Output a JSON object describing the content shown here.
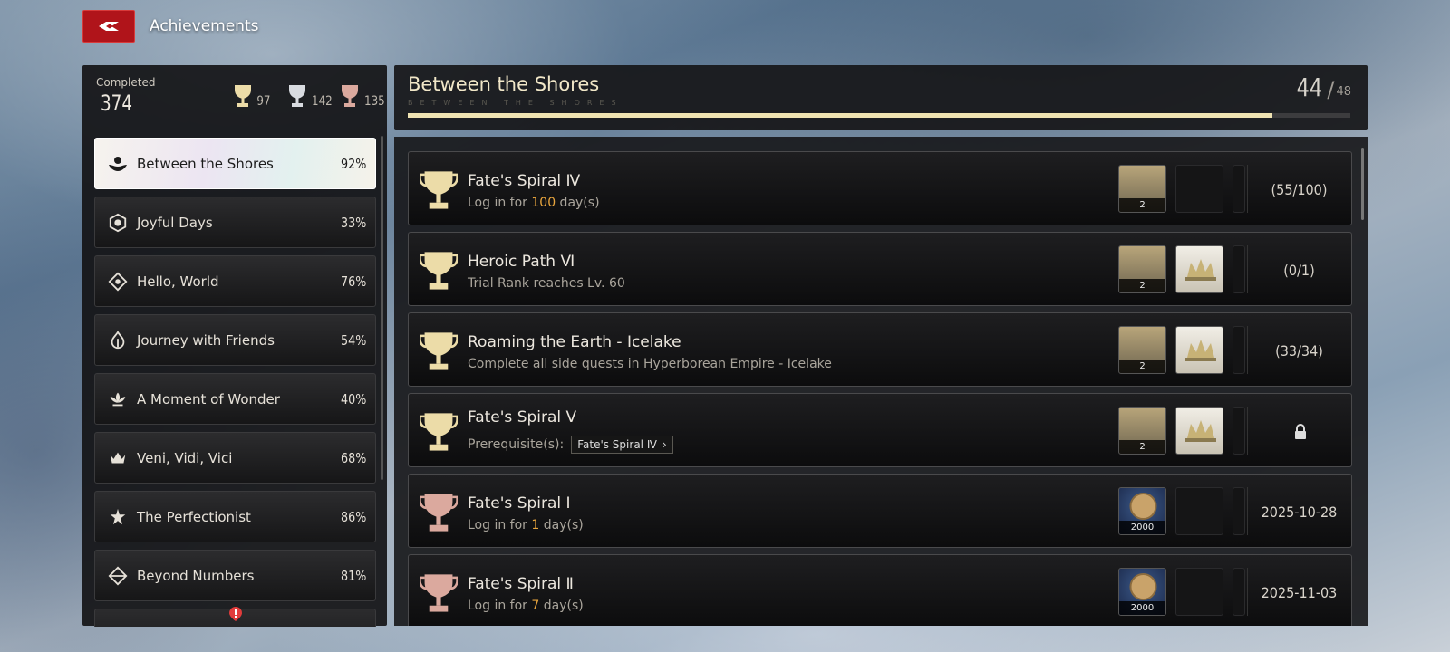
{
  "app": {
    "title": "Achievements"
  },
  "summary": {
    "completed_label": "Completed",
    "completed_value": "374",
    "gold": "97",
    "silver": "142",
    "bronze": "135"
  },
  "categories": [
    {
      "name": "Between the Shores",
      "pct": "92%",
      "active": true
    },
    {
      "name": "Joyful Days",
      "pct": "33%"
    },
    {
      "name": "Hello, World",
      "pct": "76%"
    },
    {
      "name": "Journey with Friends",
      "pct": "54%"
    },
    {
      "name": "A Moment of Wonder",
      "pct": "40%"
    },
    {
      "name": "Veni, Vidi, Vici",
      "pct": "68%"
    },
    {
      "name": "The Perfectionist",
      "pct": "86%"
    },
    {
      "name": "Beyond Numbers",
      "pct": "81%"
    }
  ],
  "header": {
    "title": "Between the Shores",
    "subtitle": "BETWEEN THE SHORES",
    "done": "44",
    "total": "48",
    "progress_fraction": 0.917
  },
  "achievements": [
    {
      "name": "Fate's Spiral Ⅳ",
      "desc_pre": "Log in for ",
      "desc_hl": "100",
      "desc_post": " day(s)",
      "reward1": "2",
      "status": "(55/100)",
      "tier": "gold"
    },
    {
      "name": "Heroic Path Ⅵ",
      "desc_pre": "Trial Rank reaches Lv. 60",
      "desc_hl": "",
      "desc_post": "",
      "reward1": "2",
      "status": "(0/1)",
      "tier": "gold"
    },
    {
      "name": "Roaming the Earth - Icelake",
      "desc_pre": "Complete all side quests in Hyperborean Empire - Icelake",
      "desc_hl": "",
      "desc_post": "",
      "reward1": "2",
      "status": "(33/34)",
      "tier": "gold"
    },
    {
      "name": "Fate's Spiral Ⅴ",
      "prereq_label": "Prerequisite(s):",
      "prereq_chip": "Fate's Spiral Ⅳ",
      "reward1": "2",
      "status": "",
      "tier": "gold"
    },
    {
      "name": "Fate's Spiral Ⅰ",
      "desc_pre": "Log in for ",
      "desc_hl": "1",
      "desc_post": " day(s)",
      "reward1": "2000",
      "status": "2025-10-28",
      "tier": "bronze"
    },
    {
      "name": "Fate's Spiral Ⅱ",
      "desc_pre": "Log in for ",
      "desc_hl": "7",
      "desc_post": " day(s)",
      "reward1": "2000",
      "status": "2025-11-03",
      "tier": "bronze"
    }
  ],
  "colors": {
    "gold": "#e9d9a4",
    "silver": "#d5d8dc",
    "bronze": "#d9a59a",
    "accent_red": "#b0141a"
  }
}
